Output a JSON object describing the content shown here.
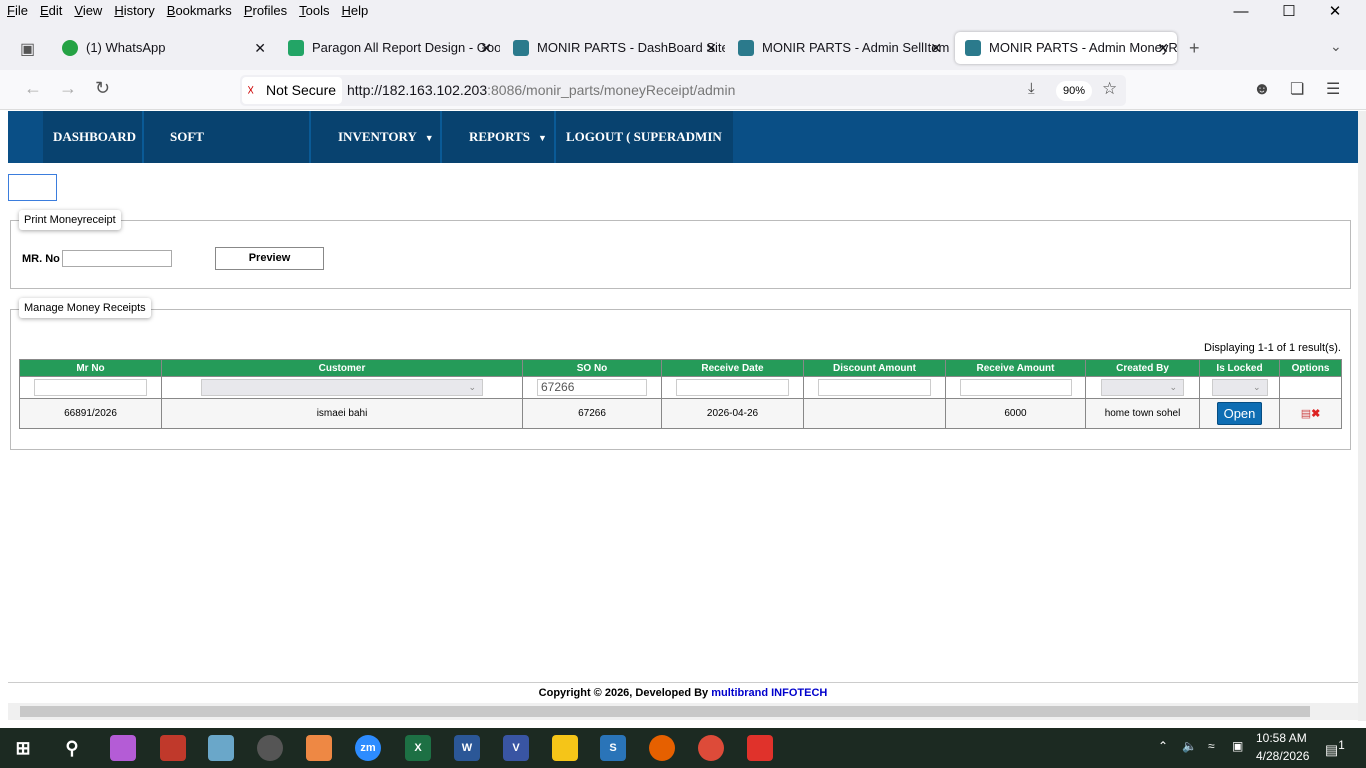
{
  "browser": {
    "menu": [
      "File",
      "Edit",
      "View",
      "History",
      "Bookmarks",
      "Profiles",
      "Tools",
      "Help"
    ],
    "tabs": [
      {
        "label": "(1) WhatsApp",
        "icon": "whatsapp-icon",
        "color": "#25a244"
      },
      {
        "label": "Paragon All Report Design - Goo",
        "icon": "sheets-icon",
        "color": "#23a566"
      },
      {
        "label": "MONIR PARTS - DashBoard Site",
        "icon": "site-icon",
        "color": "#2b7a8c"
      },
      {
        "label": "MONIR PARTS - Admin SellItem",
        "icon": "site-icon",
        "color": "#2b7a8c"
      },
      {
        "label": "MONIR PARTS - Admin MoneyR",
        "icon": "site-icon",
        "color": "#2b7a8c",
        "active": true
      }
    ],
    "not_secure": "Not Secure",
    "url_host": "http://182.163.102.203",
    "url_rest": ":8086/monir_parts/moneyReceipt/admin",
    "zoom": "90%"
  },
  "nav": {
    "items": [
      {
        "label": "DASHBOARD",
        "dropdown": false
      },
      {
        "label": "SOFT CONFIGURE",
        "dropdown": true
      },
      {
        "label": "INVENTORY",
        "dropdown": true
      },
      {
        "label": "REPORTS",
        "dropdown": true
      },
      {
        "label": "LOGOUT ( SUPERADMIN )",
        "dropdown": false
      }
    ]
  },
  "print_section": {
    "legend": "Print Moneyreceipt",
    "mr_label": "MR. No",
    "mr_value": "",
    "preview": "Preview"
  },
  "manage_section": {
    "legend": "Manage Money Receipts",
    "summary": "Displaying 1-1 of 1 result(s).",
    "columns": [
      "Mr No",
      "Customer",
      "SO No",
      "Receive Date",
      "Discount Amount",
      "Receive Amount",
      "Created By",
      "Is Locked",
      "Options"
    ],
    "filters": {
      "so_no": "67266"
    },
    "rows": [
      {
        "mr_no": "66891/2026",
        "customer": "ismaei bahi",
        "so_no": "67266",
        "receive_date": "2026-04-26",
        "discount_amount": "",
        "receive_amount": "6000",
        "created_by": "home town sohel",
        "locked_button": "Open"
      }
    ]
  },
  "footer": {
    "text": "Copyright © 2026, Developed By ",
    "link": "multibrand INFOTECH"
  },
  "taskbar": {
    "time": "10:58 AM",
    "date": "4/28/2026",
    "notifications": "1"
  },
  "colors": {
    "nav": "#0a4f86",
    "header_green": "#259b59",
    "open_button": "#0e6db3"
  }
}
